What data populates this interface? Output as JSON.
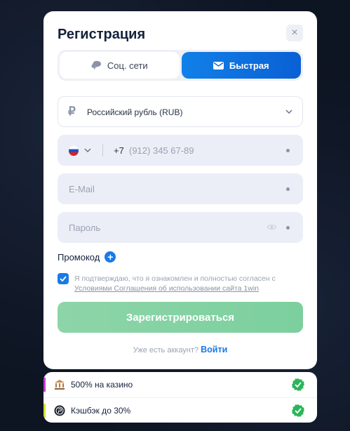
{
  "modal": {
    "title": "Регистрация",
    "close_glyph": "×",
    "tabs": [
      {
        "label": "Соц. сети",
        "icon": "chat-bubble-icon",
        "active": false
      },
      {
        "label": "Быстрая",
        "icon": "envelope-icon",
        "active": true
      }
    ],
    "currency": {
      "symbol": "₽",
      "value": "Российский рубль (RUB)"
    },
    "phone": {
      "country": "RU",
      "code": "+7",
      "placeholder": "(912) 345 67-89"
    },
    "email": {
      "placeholder": "E-Mail"
    },
    "password": {
      "placeholder": "Пароль"
    },
    "promo": {
      "label": "Промокод",
      "plus": "+"
    },
    "agreement": {
      "checked": true,
      "text": "Я подтверждаю, что я ознакомлен и полностью согласен с",
      "link": "Условиями Соглашения об использовании сайта 1win"
    },
    "submit_label": "Зарегистрироваться",
    "login_prompt": "Уже есть аккаунт?",
    "login_link": "Войти"
  },
  "bonuses": [
    {
      "label": "500% на казино",
      "icon": "bank-icon",
      "accent": "#c13fc9"
    },
    {
      "label": "Кэшбэк до 30%",
      "icon": "coin-icon",
      "accent": "#d4e230"
    }
  ],
  "colors": {
    "accent": "#1a7ae8",
    "success": "#2bb55a",
    "submit_disabled": "#8dd5a8"
  }
}
